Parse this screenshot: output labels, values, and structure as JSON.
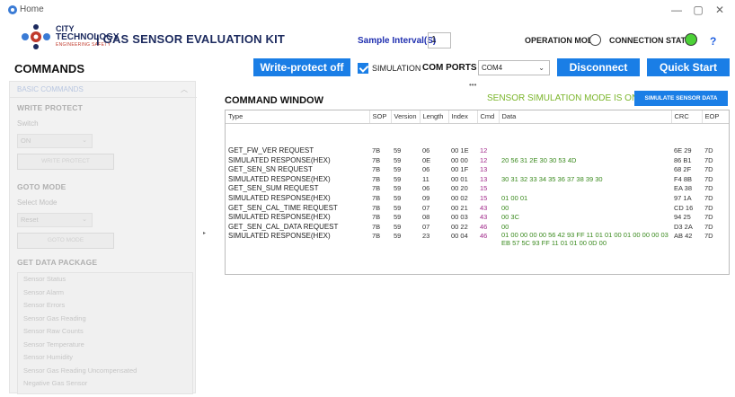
{
  "window": {
    "title": "Home",
    "controls": {
      "minimize": "—",
      "maximize": "▢",
      "close": "✕"
    }
  },
  "header": {
    "logo": {
      "line1": "CITY",
      "line2": "TECHNOLOGY",
      "line3": "ENGINEERING SAFETY"
    },
    "app_title": "| GAS SENSOR EVALUATION KIT",
    "sample_interval_label": "Sample Interval(S)",
    "sample_interval_value": "1",
    "operation_mode_label": "OPERATION MODE",
    "connection_status_label": "CONNECTION STATUS",
    "connection_status_color": "#4cd137",
    "help_label": "?"
  },
  "toolbar": {
    "commands_title": "COMMANDS",
    "write_protect_button": "Write-protect off",
    "simulation_label": "SIMULATION",
    "simulation_checked": true,
    "com_ports_label": "COM PORTS",
    "com_port_value": "COM4",
    "disconnect_button": "Disconnect",
    "quick_start_button": "Quick Start",
    "accent_color": "#1a7ee6"
  },
  "left_panel": {
    "header": "BASIC COMMANDS",
    "write_protect": {
      "title": "WRITE PROTECT",
      "switch_label": "Switch",
      "switch_value": "ON",
      "button": "WRITE PROTECT"
    },
    "goto_mode": {
      "title": "GOTO MODE",
      "select_label": "Select Mode",
      "select_value": "Reset",
      "button": "GOTO MODE"
    },
    "get_data_package": {
      "title": "GET DATA PACKAGE",
      "items": [
        "Sensor Status",
        "Sensor Alarm",
        "Sensor Errors",
        "Sensor Gas Reading",
        "Sensor Raw Counts",
        "Sensor Temperature",
        "Sensor Humidity",
        "Sensor Gas Reading Uncompensated",
        "Negative Gas Sensor"
      ]
    }
  },
  "command_window": {
    "title": "COMMAND WINDOW",
    "status": "SENSOR SIMULATION MODE IS ON..",
    "status_color": "#7ab52a",
    "simulate_button": "SIMULATE SENSOR DATA",
    "columns": [
      "Type",
      "SOP",
      "Version",
      "Length",
      "Index",
      "Cmd",
      "Data",
      "CRC",
      "EOP"
    ],
    "rows": [
      [
        "GET_FW_VER REQUEST",
        "7B",
        "59",
        "06",
        "00 1E",
        "12",
        "",
        "6E 29",
        "7D"
      ],
      [
        "SIMULATED RESPONSE(HEX)",
        "7B",
        "59",
        "0E",
        "00 00",
        "12",
        "20 56 31 2E 30 30 53 4D",
        "86 B1",
        "7D"
      ],
      [
        "GET_SEN_SN REQUEST",
        "7B",
        "59",
        "06",
        "00 1F",
        "13",
        "",
        "68 2F",
        "7D"
      ],
      [
        "SIMULATED RESPONSE(HEX)",
        "7B",
        "59",
        "11",
        "00 01",
        "13",
        "30 31 32 33 34 35 36 37 38 39 30",
        "F4 8B",
        "7D"
      ],
      [
        "GET_SEN_SUM REQUEST",
        "7B",
        "59",
        "06",
        "00 20",
        "15",
        "",
        "EA 38",
        "7D"
      ],
      [
        "SIMULATED RESPONSE(HEX)",
        "7B",
        "59",
        "09",
        "00 02",
        "15",
        "01 00 01",
        "97 1A",
        "7D"
      ],
      [
        "GET_SEN_CAL_TIME REQUEST",
        "7B",
        "59",
        "07",
        "00 21",
        "43",
        "00",
        "CD 16",
        "7D"
      ],
      [
        "SIMULATED RESPONSE(HEX)",
        "7B",
        "59",
        "08",
        "00 03",
        "43",
        "00 3C",
        "94 25",
        "7D"
      ],
      [
        "GET_SEN_CAL_DATA REQUEST",
        "7B",
        "59",
        "07",
        "00 22",
        "46",
        "00",
        "D3 2A",
        "7D"
      ],
      [
        "SIMULATED RESPONSE(HEX)",
        "7B",
        "59",
        "23",
        "00 04",
        "46",
        "01 00 00 00 00 56 42 93 FF 11 01 01 00 01 00 00 00 03 EB 57 5C 93 FF 11 01 01 00 0D 00",
        "AB 42",
        "7D"
      ]
    ]
  }
}
